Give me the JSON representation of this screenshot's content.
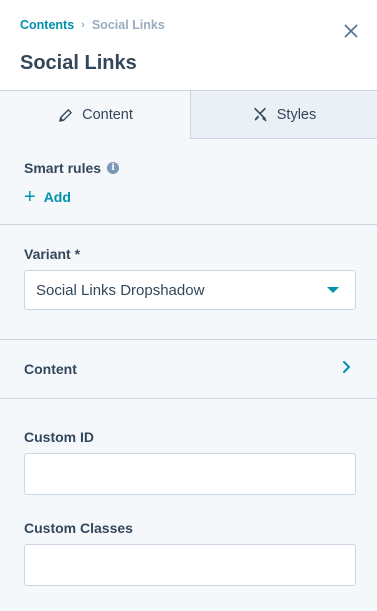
{
  "breadcrumb": {
    "parent": "Contents",
    "separator": "›",
    "current": "Social Links"
  },
  "title": "Social Links",
  "tabs": [
    {
      "label": "Content",
      "icon": "pencil-icon",
      "active": true
    },
    {
      "label": "Styles",
      "icon": "brush-icon",
      "active": false
    }
  ],
  "smart_rules": {
    "label": "Smart rules",
    "add_label": "Add"
  },
  "variant": {
    "label": "Variant *",
    "value": "Social Links Dropshadow"
  },
  "content_section": {
    "label": "Content"
  },
  "custom_id": {
    "label": "Custom ID",
    "value": ""
  },
  "custom_classes": {
    "label": "Custom Classes",
    "value": ""
  },
  "colors": {
    "accent": "#0091ae",
    "text": "#33475b",
    "muted": "#99acc2",
    "border": "#cbd6e2",
    "panel": "#f5f8fa"
  }
}
